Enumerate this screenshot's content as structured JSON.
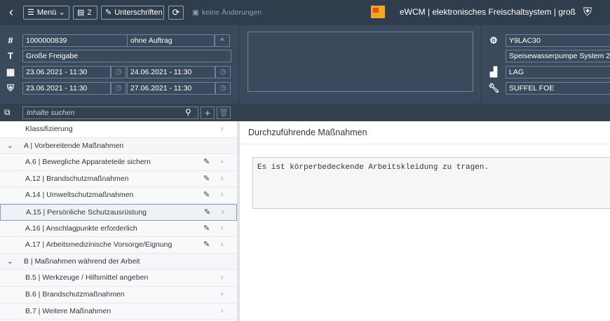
{
  "toolbar": {
    "back_icon": "chevron-left-icon",
    "menu_label": "Menü",
    "count_label": "2",
    "signatures_label": "Unterschriften",
    "no_changes_label": "keine Änderungen",
    "app_title": "eWCM | elektronisches Freischaltsystem | groß"
  },
  "header": {
    "order_number": "1000000839",
    "order_status": "ohne Auftrag",
    "title": "Große Freigabe",
    "date_row1_start": "23.06.2021 - 11:30",
    "date_row1_end": "24.06.2021 - 11:30",
    "date_row2_start": "23.06.2021 - 11:30",
    "date_row2_end": "27.06.2021 - 11:30",
    "equipment_id": "Y9LAC30",
    "equipment_name": "Speisewasserpumpe System 2",
    "location": "LAG",
    "technician": "SUFFEL FOE"
  },
  "search": {
    "placeholder": "Inhalte suchen"
  },
  "list": {
    "items": [
      {
        "label": "Klassifizierung",
        "kind": "top"
      },
      {
        "label": "A | Vorbereitende Maßnahmen",
        "kind": "group"
      },
      {
        "label": "A.6 | Bewegliche Apparateteile sichern",
        "kind": "sub"
      },
      {
        "label": "A.12 | Brandschutzmaßnahmen",
        "kind": "sub"
      },
      {
        "label": "A.14 | Umweltschutzmaßnahmen",
        "kind": "sub"
      },
      {
        "label": "A.15 | Persönliche Schutzausrüstung",
        "kind": "sub",
        "selected": true
      },
      {
        "label": "A.16 | Anschlagpunkte erforderlich",
        "kind": "sub"
      },
      {
        "label": "A.17 | Arbeitsmedizinische Vorsorge/Eignung",
        "kind": "sub"
      },
      {
        "label": "B | Maßnahmen während der Arbeit",
        "kind": "group"
      },
      {
        "label": "B.5 | Werkzeuge / Hilfsmittel angeben",
        "kind": "sub"
      },
      {
        "label": "B.6 | Brandschutzmaßnahmen",
        "kind": "sub"
      },
      {
        "label": "B.7 | Weitere Maßnahmen",
        "kind": "sub"
      }
    ]
  },
  "content": {
    "title": "Durchzuführende Maßnahmen",
    "text": "Es ist körperbedeckende Arbeitskleidung zu tragen."
  },
  "colors": {
    "toolbar_bg": "#2f3d4d",
    "header_bg": "#3a4a5c",
    "logo_orange": "#f3a623",
    "logo_red": "#e05024"
  }
}
